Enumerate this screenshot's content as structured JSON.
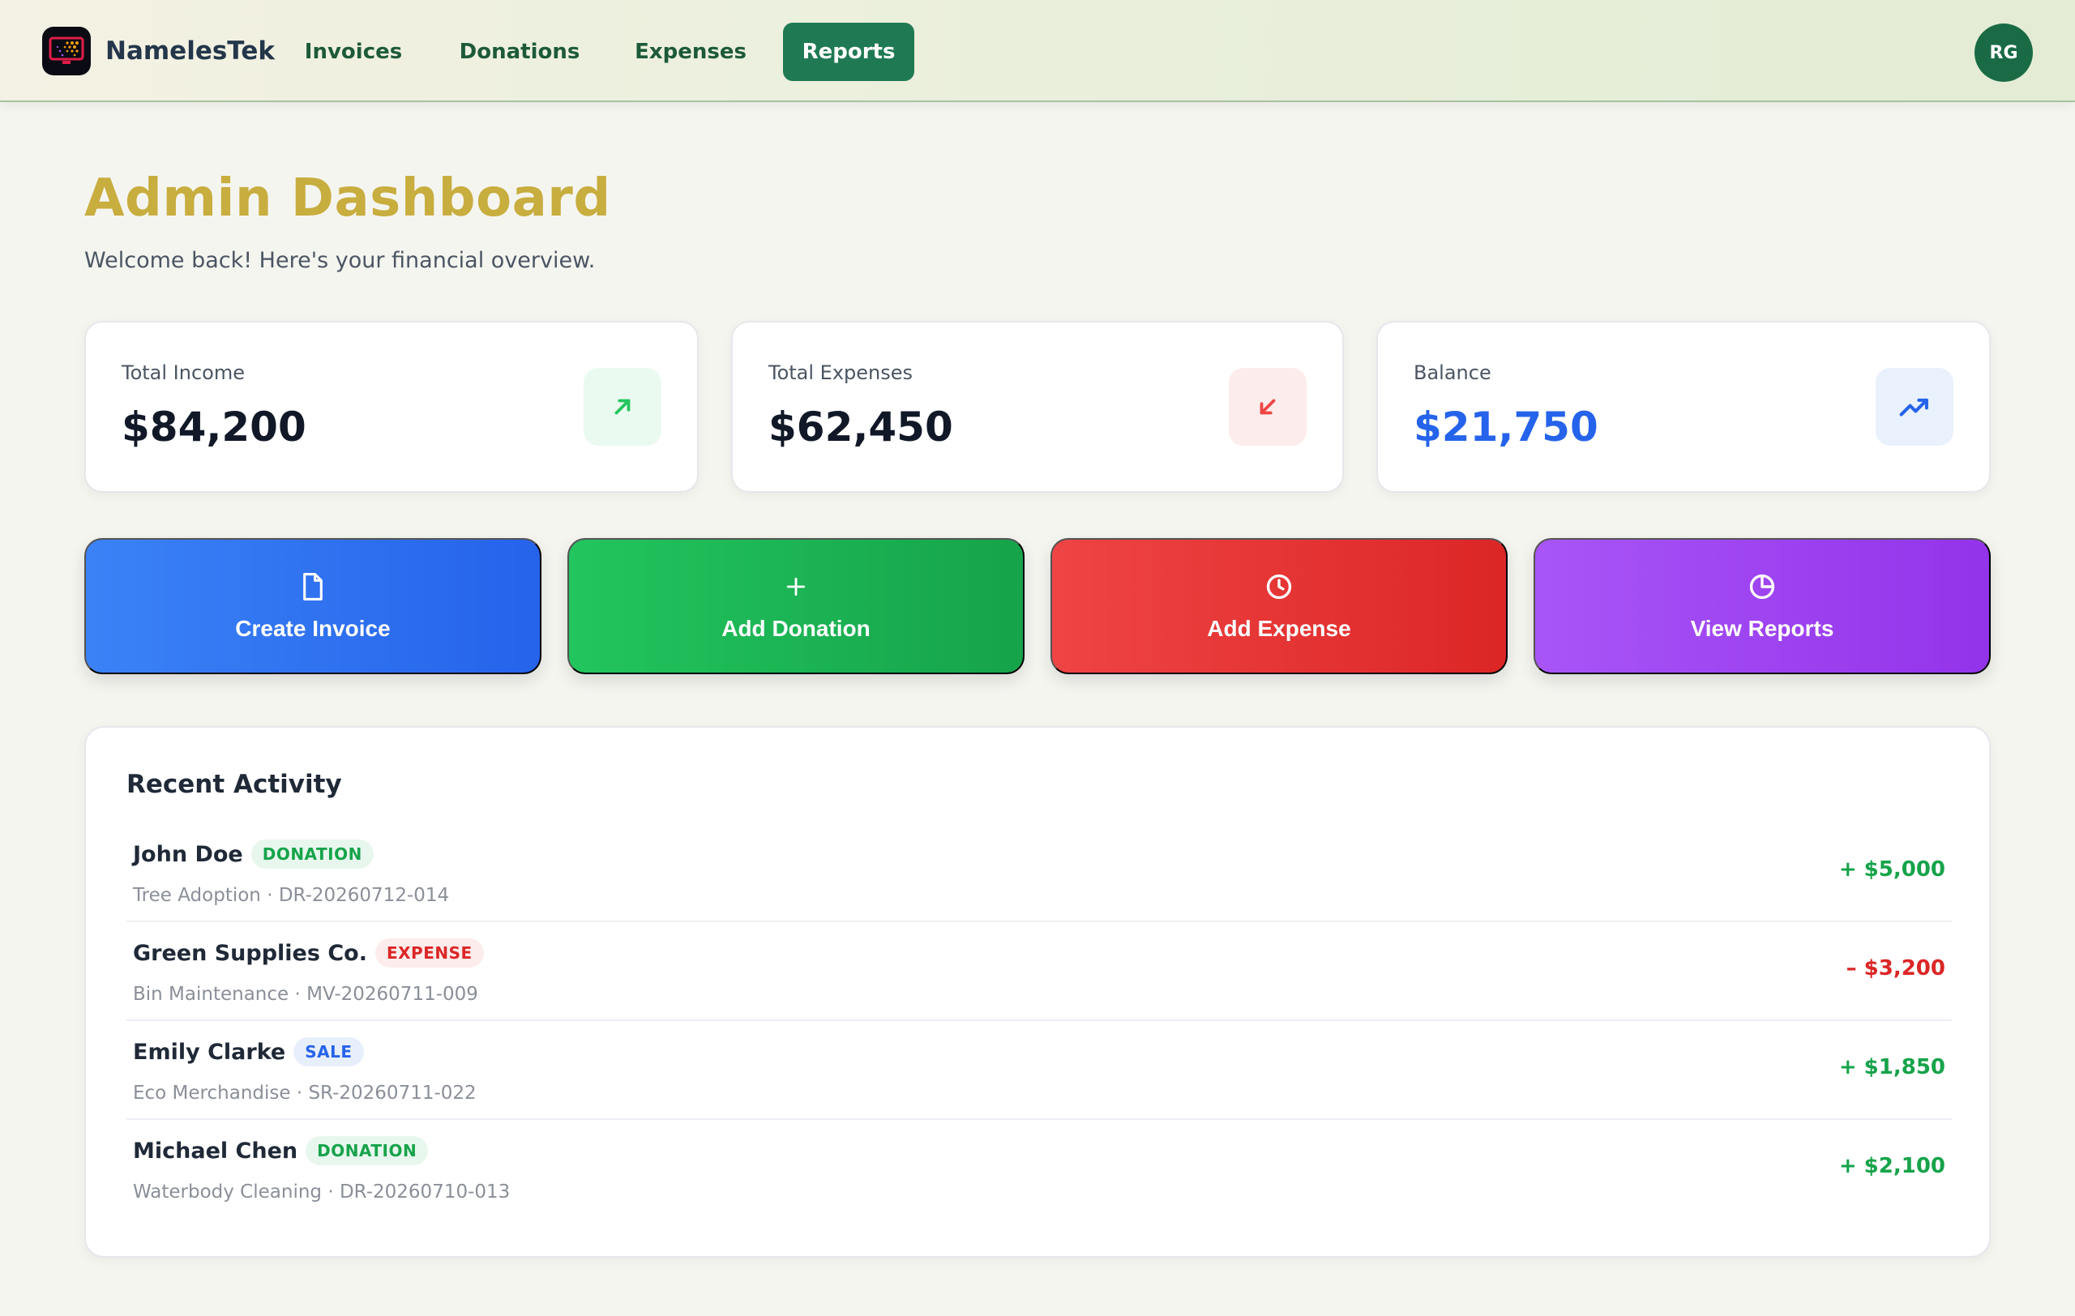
{
  "nav": {
    "brand": "NamelesTek",
    "links": [
      {
        "label": "Invoices",
        "active": false
      },
      {
        "label": "Donations",
        "active": false
      },
      {
        "label": "Expenses",
        "active": false
      },
      {
        "label": "Reports",
        "active": true
      }
    ],
    "avatar_initials": "RG"
  },
  "header": {
    "title": "Admin Dashboard",
    "subtitle": "Welcome back! Here's your financial overview."
  },
  "stats": [
    {
      "label": "Total Income",
      "value": "$84,200",
      "icon": "arrow-up-right-icon",
      "color": "#22c55e"
    },
    {
      "label": "Total Expenses",
      "value": "$62,450",
      "icon": "arrow-down-left-icon",
      "color": "#ef4444"
    },
    {
      "label": "Balance",
      "value": "$21,750",
      "icon": "trending-up-icon",
      "color": "#2563eb"
    }
  ],
  "actions": [
    {
      "label": "Create Invoice",
      "icon": "file-icon"
    },
    {
      "label": "Add Donation",
      "icon": "plus-icon"
    },
    {
      "label": "Add Expense",
      "icon": "clock-icon"
    },
    {
      "label": "View Reports",
      "icon": "pie-chart-icon"
    }
  ],
  "activity": {
    "title": "Recent Activity",
    "items": [
      {
        "name": "John Doe",
        "tag": "DONATION",
        "meta": "Tree Adoption · DR-20260712-014",
        "amount": "+ $5,000"
      },
      {
        "name": "Green Supplies Co.",
        "tag": "EXPENSE",
        "meta": "Bin Maintenance · MV-20260711-009",
        "amount": "– $3,200"
      },
      {
        "name": "Emily Clarke",
        "tag": "SALE",
        "meta": "Eco Merchandise · SR-20260711-022",
        "amount": "+ $1,850"
      },
      {
        "name": "Michael Chen",
        "tag": "DONATION",
        "meta": "Waterbody Cleaning · DR-20260710-013",
        "amount": "+ $2,100"
      }
    ]
  },
  "colors": {
    "brand_green": "#1f7a53",
    "title_gold": "#c8ad3f",
    "income_green": "#16a34a",
    "expense_red": "#dc2626",
    "balance_blue": "#2563eb"
  }
}
